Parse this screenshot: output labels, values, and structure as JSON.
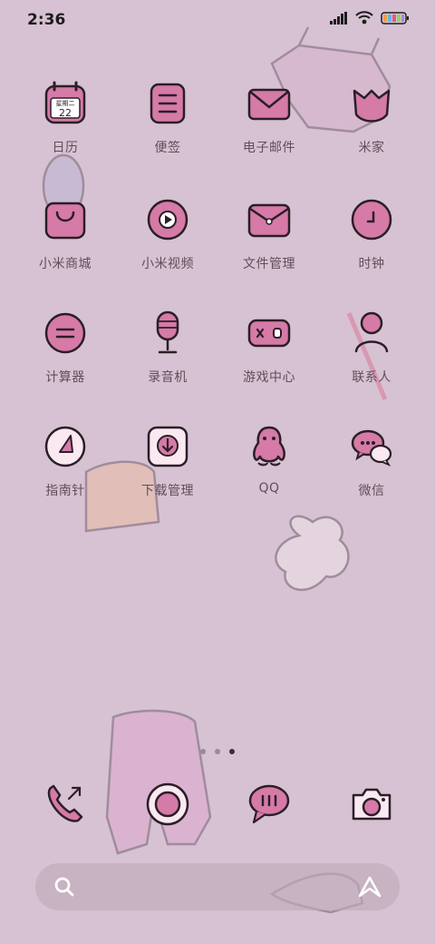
{
  "status": {
    "time": "2:36"
  },
  "apps": [
    {
      "label": "日历",
      "icon": "calendar-icon",
      "cal_weekday": "星期二",
      "cal_day": "22"
    },
    {
      "label": "便签",
      "icon": "notes-icon"
    },
    {
      "label": "电子邮件",
      "icon": "email-icon"
    },
    {
      "label": "米家",
      "icon": "mihome-icon"
    },
    {
      "label": "小米商城",
      "icon": "shopping-bag-icon"
    },
    {
      "label": "小米视频",
      "icon": "video-play-icon"
    },
    {
      "label": "文件管理",
      "icon": "folder-icon"
    },
    {
      "label": "时钟",
      "icon": "clock-icon"
    },
    {
      "label": "计算器",
      "icon": "calculator-icon"
    },
    {
      "label": "录音机",
      "icon": "microphone-icon"
    },
    {
      "label": "游戏中心",
      "icon": "gamepad-icon"
    },
    {
      "label": "联系人",
      "icon": "contact-icon"
    },
    {
      "label": "指南针",
      "icon": "compass-icon"
    },
    {
      "label": "下载管理",
      "icon": "download-icon"
    },
    {
      "label": "QQ",
      "icon": "qq-penguin-icon"
    },
    {
      "label": "微信",
      "icon": "wechat-icon"
    }
  ],
  "dock": [
    "phone-icon",
    "browser-icon",
    "message-icon",
    "camera-icon"
  ],
  "page_indicator": {
    "count": 3,
    "active": 2
  },
  "colors": {
    "background": "#d6c2d2",
    "icon_pink": "#cf7aa6",
    "outline": "#2a1f26"
  }
}
